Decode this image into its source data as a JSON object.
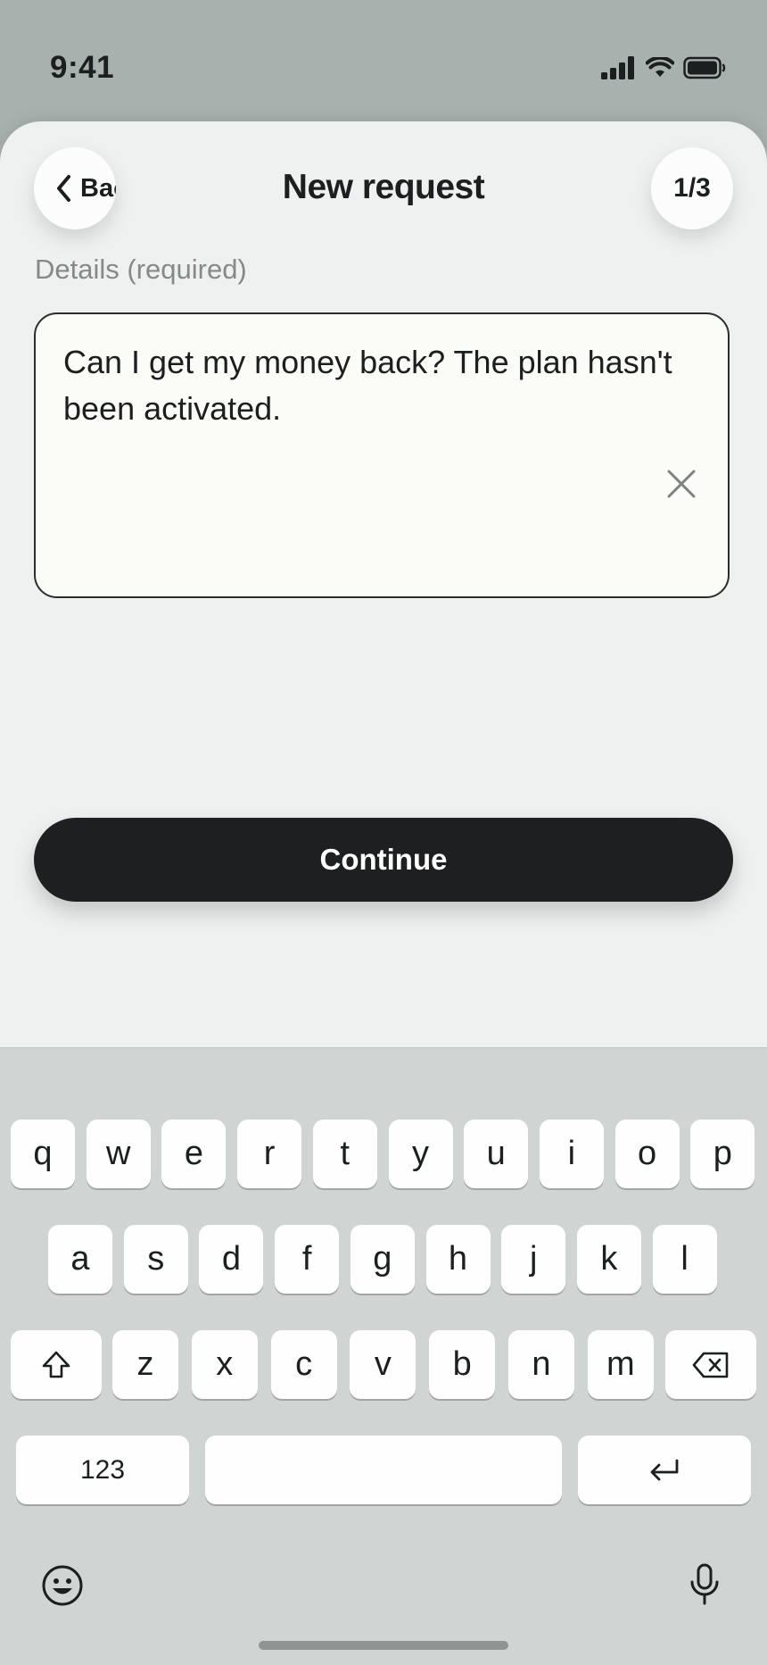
{
  "status_bar": {
    "time": "9:41",
    "icons": [
      "cellular-signal-icon",
      "wifi-icon",
      "battery-icon"
    ]
  },
  "header": {
    "back_label": "Back",
    "title": "New request",
    "step": "1/3"
  },
  "form": {
    "details_label": "Details (required)",
    "details_value": "Can I get my money back? The plan hasn't been activated."
  },
  "actions": {
    "continue_label": "Continue"
  },
  "keyboard": {
    "row1": [
      "q",
      "w",
      "e",
      "r",
      "t",
      "y",
      "u",
      "i",
      "o",
      "p"
    ],
    "row2": [
      "a",
      "s",
      "d",
      "f",
      "g",
      "h",
      "j",
      "k",
      "l"
    ],
    "row3": [
      "z",
      "x",
      "c",
      "v",
      "b",
      "n",
      "m"
    ],
    "numbers_label": "123",
    "icons": [
      "shift-icon",
      "delete-icon",
      "return-icon",
      "emoji-icon",
      "microphone-icon"
    ]
  },
  "colors": {
    "sheet": "#eff1f0",
    "button": "#1d1f20",
    "keyboard": "#d0d4d2",
    "backdrop": "#a9b1ae"
  }
}
